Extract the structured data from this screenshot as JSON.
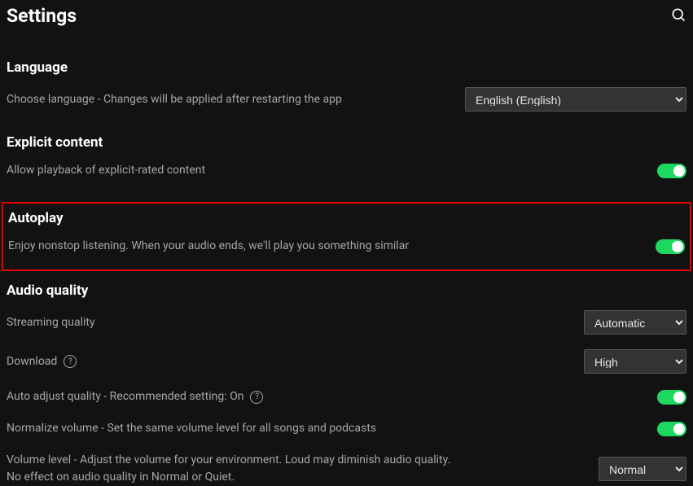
{
  "page": {
    "title": "Settings"
  },
  "language": {
    "heading": "Language",
    "desc": "Choose language - Changes will be applied after restarting the app",
    "selected": "English (English)"
  },
  "explicit": {
    "heading": "Explicit content",
    "desc": "Allow playback of explicit-rated content",
    "enabled": true
  },
  "autoplay": {
    "heading": "Autoplay",
    "desc": "Enjoy nonstop listening. When your audio ends, we'll play you something similar",
    "enabled": true
  },
  "audio": {
    "heading": "Audio quality",
    "streaming": {
      "label": "Streaming quality",
      "selected": "Automatic"
    },
    "download": {
      "label": "Download",
      "selected": "High"
    },
    "auto_adjust": {
      "label": "Auto adjust quality - Recommended setting: On",
      "enabled": true
    },
    "normalize": {
      "label": "Normalize volume - Set the same volume level for all songs and podcasts",
      "enabled": true
    },
    "volume_level": {
      "label": "Volume level - Adjust the volume for your environment. Loud may diminish audio quality. No effect on audio quality in Normal or Quiet.",
      "selected": "Normal"
    }
  }
}
